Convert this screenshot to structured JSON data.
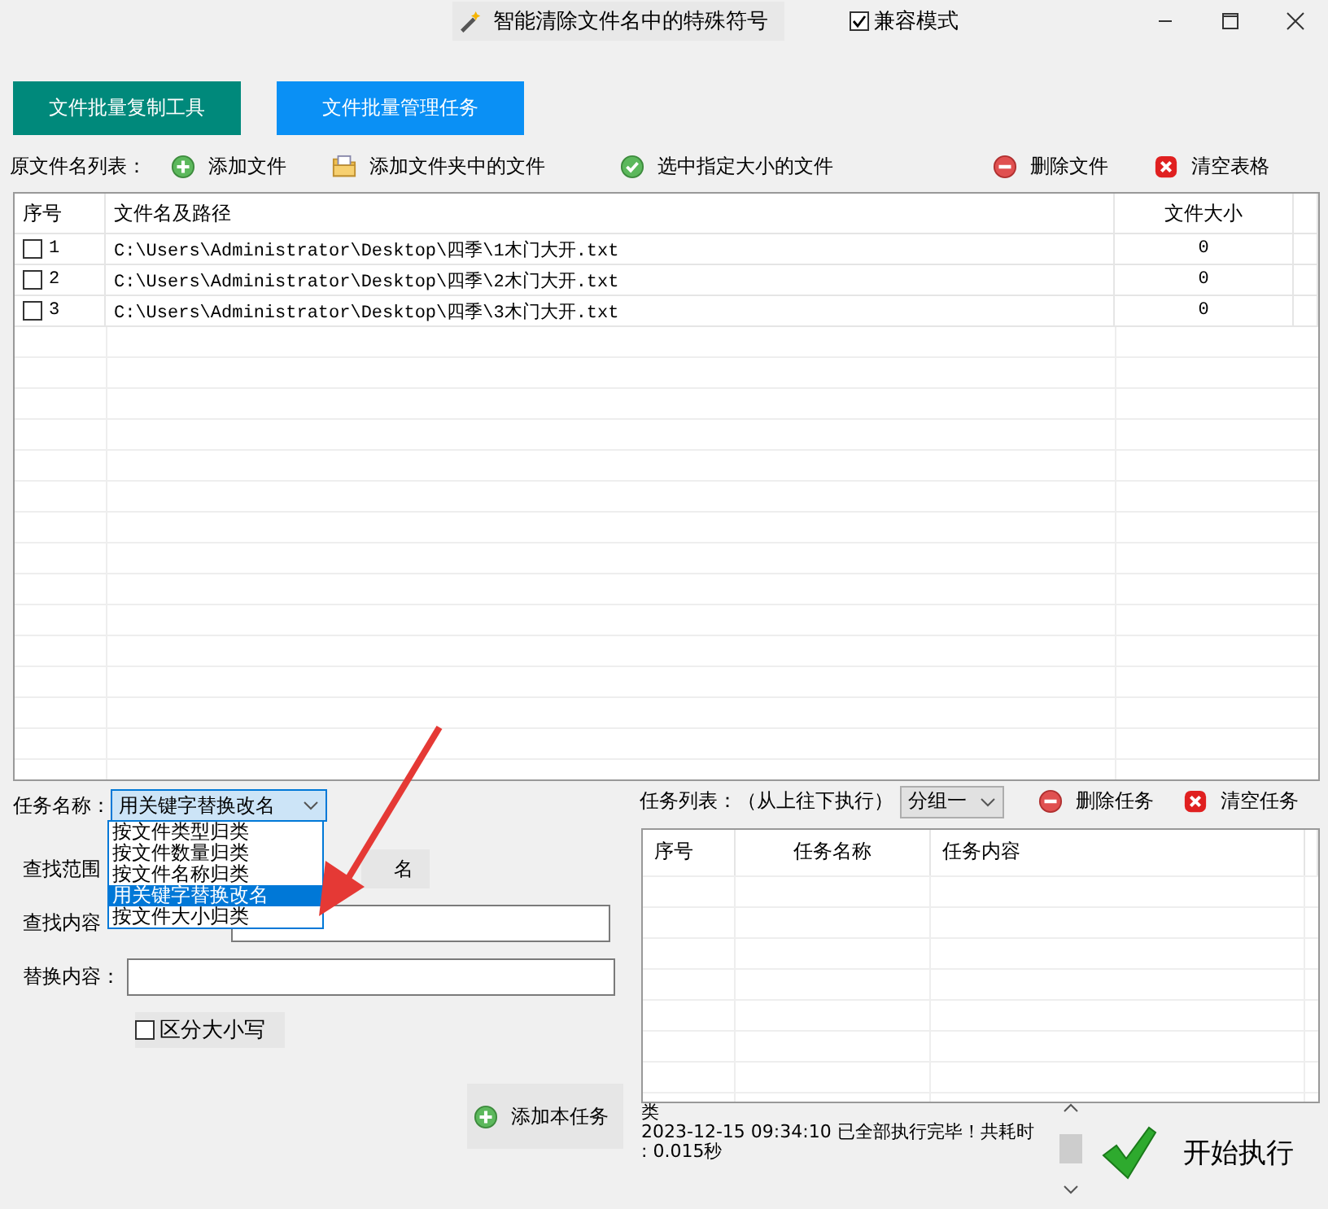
{
  "title_bar": {
    "title": "智能清除文件名中的特殊符号",
    "compat_mode": {
      "label": "兼容模式",
      "checked": true
    }
  },
  "tabs": [
    {
      "label": "文件批量复制工具",
      "selected": false
    },
    {
      "label": "文件批量管理任务",
      "selected": true
    }
  ],
  "file_toolbar": {
    "label": "原文件名列表：",
    "buttons": [
      {
        "label": "添加文件",
        "kind": "add"
      },
      {
        "label": "添加文件夹中的文件",
        "kind": "folder"
      },
      {
        "label": "选中指定大小的文件",
        "kind": "check"
      },
      {
        "label": "删除文件",
        "kind": "delete"
      },
      {
        "label": "清空表格",
        "kind": "clear"
      }
    ]
  },
  "file_table": {
    "columns": [
      "序号",
      "文件名及路径",
      "文件大小"
    ],
    "rows": [
      {
        "index": "1",
        "checked": false,
        "path": "C:\\Users\\Administrator\\Desktop\\四季\\1木门大开.txt",
        "size": "0"
      },
      {
        "index": "2",
        "checked": false,
        "path": "C:\\Users\\Administrator\\Desktop\\四季\\2木门大开.txt",
        "size": "0"
      },
      {
        "index": "3",
        "checked": false,
        "path": "C:\\Users\\Administrator\\Desktop\\四季\\3木门大开.txt",
        "size": "0"
      }
    ]
  },
  "task_form": {
    "task_name": {
      "label": "任务名称：",
      "value": "用关键字替换改名",
      "options": [
        {
          "label": "按文件类型归类",
          "selected": false
        },
        {
          "label": "按文件数量归类",
          "selected": false
        },
        {
          "label": "按文件名称归类",
          "selected": false
        },
        {
          "label": "用关键字替换改名",
          "selected": true
        },
        {
          "label": "按文件大小归类",
          "selected": false
        }
      ]
    },
    "search_scope": {
      "label": "查找范围",
      "option_text": "名"
    },
    "find": {
      "label": "查找内容"
    },
    "replace": {
      "label": "替换内容："
    },
    "case_sensitive": {
      "label": "区分大小写",
      "checked": false
    },
    "add_button": "添加本任务"
  },
  "task_panel": {
    "label": "任务列表：（从上往下执行）",
    "group": "分组一",
    "buttons": [
      {
        "label": "删除任务",
        "kind": "delete"
      },
      {
        "label": "清空任务",
        "kind": "clear"
      }
    ],
    "columns": [
      "序号",
      "任务名称",
      "任务内容"
    ]
  },
  "log": [
    "类",
    "2023-12-15 09:34:10 已全部执行完毕！共耗时",
    ": 0.015秒"
  ],
  "start_button": "开始执行"
}
